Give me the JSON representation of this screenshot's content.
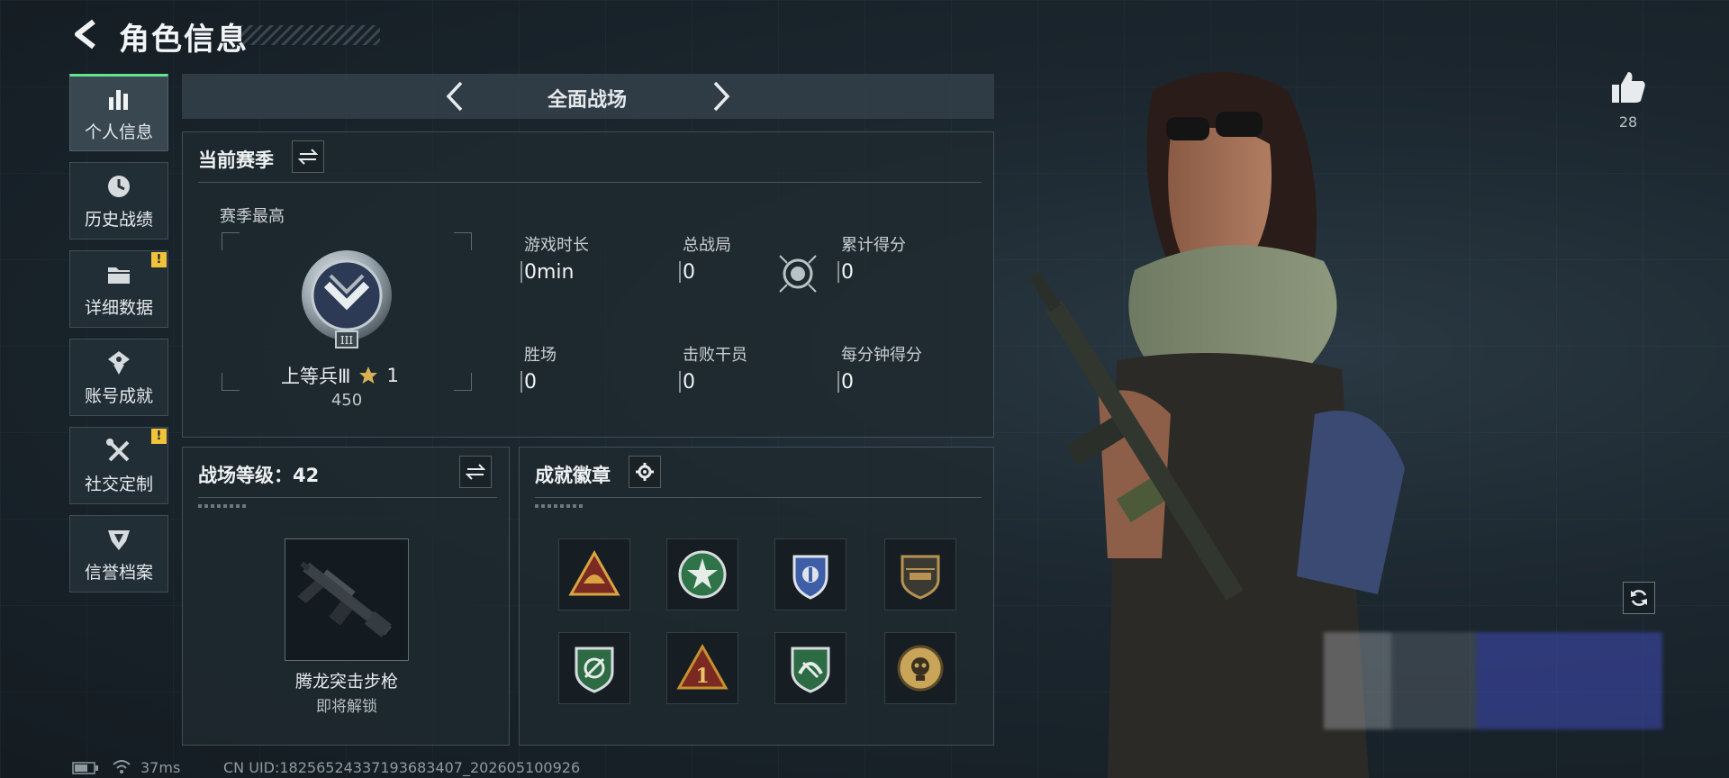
{
  "header": {
    "title": "角色信息"
  },
  "sidebar": {
    "items": [
      {
        "label": "个人信息",
        "icon": "bar-chart-icon",
        "active": true,
        "alert": false
      },
      {
        "label": "历史战绩",
        "icon": "clock-icon",
        "active": false,
        "alert": false
      },
      {
        "label": "详细数据",
        "icon": "folder-icon",
        "active": false,
        "alert": true
      },
      {
        "label": "账号成就",
        "icon": "medal-icon",
        "active": false,
        "alert": false
      },
      {
        "label": "社交定制",
        "icon": "tools-icon",
        "active": false,
        "alert": true
      },
      {
        "label": "信誉档案",
        "icon": "shield-icon",
        "active": false,
        "alert": false
      }
    ],
    "alert_mark": "!"
  },
  "mode": {
    "title": "全面战场"
  },
  "season": {
    "title": "当前赛季",
    "best_label": "赛季最高",
    "rank_name": "上等兵Ⅲ",
    "stars": "1",
    "rank_points": "450",
    "rank_emblem_numeral": "III",
    "stats": [
      {
        "label": "游戏时长",
        "value": "0min"
      },
      {
        "label": "总战局",
        "value": "0"
      },
      {
        "label": "累计得分",
        "value": "0"
      },
      {
        "label": "胜场",
        "value": "0"
      },
      {
        "label": "击败干员",
        "value": "0"
      },
      {
        "label": "每分钟得分",
        "value": "0"
      }
    ]
  },
  "battle_level": {
    "title": "战场等级：42",
    "weapon_name": "腾龙突击步枪",
    "weapon_status": "即将解锁"
  },
  "achievements": {
    "title": "成就徽章",
    "badge_digit": "1",
    "badges": [
      {
        "icon": "tri-helmet-badge-icon",
        "color": "#d9a441"
      },
      {
        "icon": "green-star-badge-icon",
        "color": "#3f8f5c"
      },
      {
        "icon": "blue-shield-badge-icon",
        "color": "#5a79c7"
      },
      {
        "icon": "helicopter-badge-icon",
        "color": "#b89250"
      },
      {
        "icon": "green-crosshair-badge-icon",
        "color": "#3d8a56"
      },
      {
        "icon": "gold-triangle-1-badge-icon",
        "color": "#c8902e"
      },
      {
        "icon": "green-wing-badge-icon",
        "color": "#3d8a56"
      },
      {
        "icon": "skull-emblem-badge-icon",
        "color": "#c9a55a"
      }
    ]
  },
  "likes": {
    "count": "28"
  },
  "status_bar": {
    "ping": "37ms",
    "uid": "CN UID:18256524337193683407_202605100926"
  },
  "colors": {
    "accent_green": "#64e28f",
    "alert_yellow": "#f0c43a",
    "panel_bg": "#1e2930"
  }
}
